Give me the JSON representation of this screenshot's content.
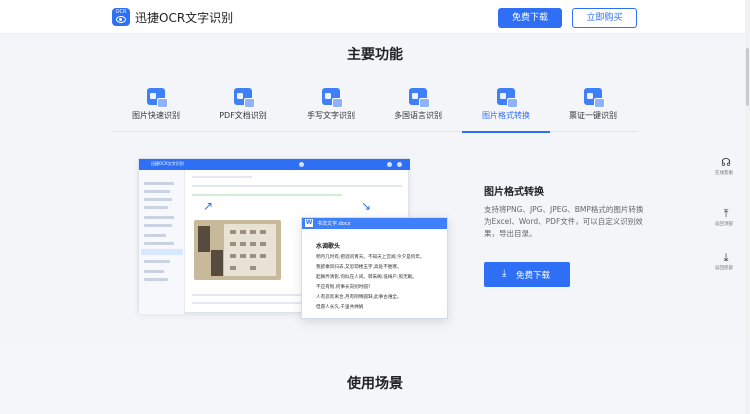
{
  "header": {
    "logo_text": "OCR",
    "brand": "迅捷OCR文字识别",
    "free_download": "免费下载",
    "buy_now": "立即购买"
  },
  "features": {
    "title": "主要功能",
    "tabs": [
      {
        "label": "图片快速识别",
        "icon": "image-ocr-icon"
      },
      {
        "label": "PDF文档识别",
        "icon": "pdf-ocr-icon"
      },
      {
        "label": "手写文字识别",
        "icon": "handwriting-icon"
      },
      {
        "label": "多国语言识别",
        "icon": "globe-language-icon"
      },
      {
        "label": "图片格式转换",
        "icon": "image-convert-icon",
        "active": true
      },
      {
        "label": "票证一键识别",
        "icon": "ticket-ocr-icon"
      }
    ],
    "active": {
      "title": "图片格式转换",
      "description": "支持将PNG、JPG、JPEG、BMP格式的图片转换为Excel、Word、PDF文件，可以自定义识别效果，导出目录。",
      "button": "免费下载"
    },
    "mock": {
      "app_title": "迅捷OCR文字识别",
      "doc_name": "书法文字.docx",
      "doc_title": "水调歌头",
      "doc_lines": [
        "明月几时有,把酒问青天。不知天上宫阙,今夕是何年。",
        "我欲乘风归去,又恐琼楼玉宇,高处不胜寒。",
        "起舞弄清影,何似在人间。转朱阁,低绮户,照无眠。",
        "不应有恨,何事长向别时圆?",
        "人有悲欢离合,月有阴晴圆缺,此事古难全。",
        "但愿人长久,千里共婵娟"
      ]
    }
  },
  "float_bar": [
    {
      "label": "在线客服",
      "icon": "headset-icon"
    },
    {
      "label": "返回顶部",
      "icon": "arrow-up-icon"
    },
    {
      "label": "返回底部",
      "icon": "download-icon"
    }
  ],
  "usage": {
    "title": "使用场景"
  },
  "colors": {
    "accent": "#2f6ff5",
    "bg": "#f3f5f9"
  }
}
